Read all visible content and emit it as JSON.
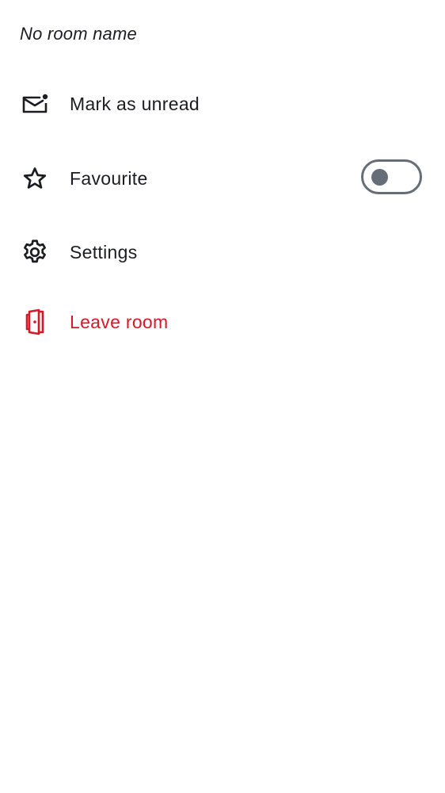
{
  "room": {
    "name": "No room name"
  },
  "menu": {
    "items": [
      {
        "label": "Mark as unread",
        "icon": "mail-unread-icon"
      },
      {
        "label": "Favourite",
        "icon": "star-icon",
        "toggle_on": false
      },
      {
        "label": "Settings",
        "icon": "gear-icon"
      },
      {
        "label": "Leave room",
        "icon": "leave-door-icon"
      }
    ]
  },
  "colors": {
    "text": "#1b1d22",
    "danger": "#d51928",
    "toggle_off": "#656d77"
  }
}
